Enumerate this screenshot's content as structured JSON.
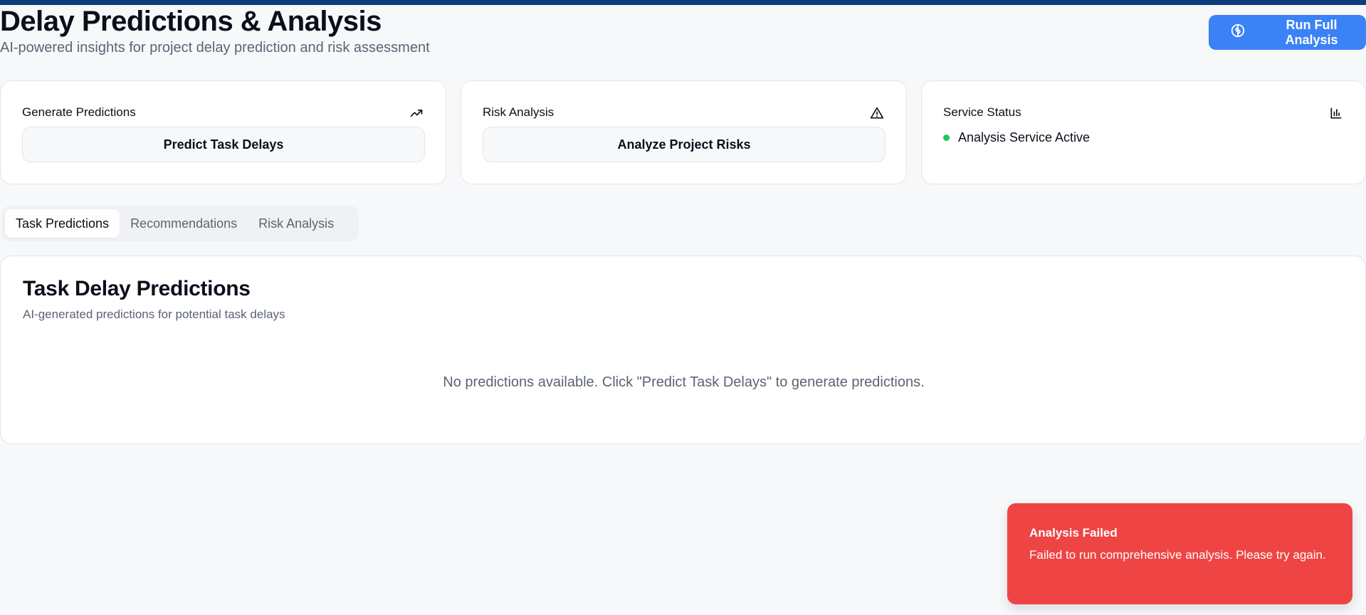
{
  "header": {
    "title": "Delay Predictions & Analysis",
    "subtitle": "AI-powered insights for project delay prediction and risk assessment",
    "run_button_label": "Run Full Analysis"
  },
  "cards": {
    "predictions": {
      "title": "Generate Predictions",
      "icon": "trending-up-icon",
      "button_label": "Predict Task Delays"
    },
    "risk": {
      "title": "Risk Analysis",
      "icon": "alert-triangle-icon",
      "button_label": "Analyze Project Risks"
    },
    "status": {
      "title": "Service Status",
      "icon": "bar-chart-icon",
      "status_text": "Analysis Service Active",
      "status_color": "#22c55e"
    }
  },
  "tabs": [
    {
      "label": "Task Predictions",
      "active": true
    },
    {
      "label": "Recommendations",
      "active": false
    },
    {
      "label": "Risk Analysis",
      "active": false
    }
  ],
  "panel": {
    "title": "Task Delay Predictions",
    "subtitle": "AI-generated predictions for potential task delays",
    "empty_message": "No predictions available. Click \"Predict Task Delays\" to generate predictions."
  },
  "toast": {
    "title": "Analysis Failed",
    "message": "Failed to run comprehensive analysis. Please try again.",
    "color": "#ef4444"
  },
  "colors": {
    "accent": "#3b82f6",
    "topbar": "#0a3d7a"
  }
}
